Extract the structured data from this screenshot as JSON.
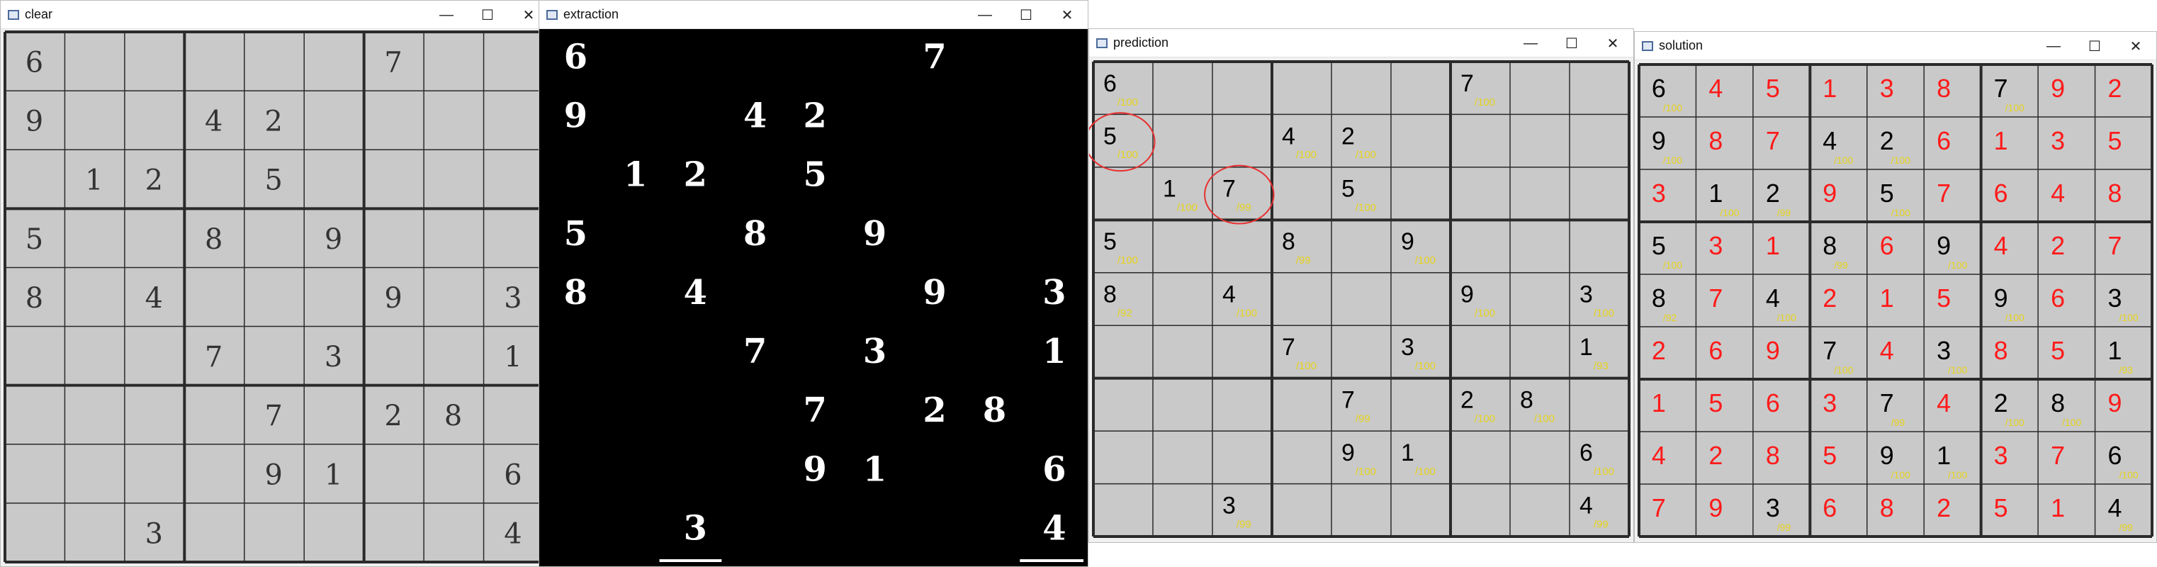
{
  "windows": {
    "clear": {
      "title": "clear"
    },
    "extraction": {
      "title": "extraction"
    },
    "prediction": {
      "title": "prediction"
    },
    "solution": {
      "title": "solution"
    }
  },
  "controls": {
    "minimize": "—",
    "maximize": "☐",
    "close": "✕"
  },
  "colors": {
    "given_digit": "#000000",
    "solved_digit": "#ff1a1a",
    "confidence": "#e6d21a",
    "circle": "#e83030",
    "paper": "#c9c9c9"
  },
  "puzzle": [
    [
      6,
      0,
      0,
      0,
      0,
      0,
      7,
      0,
      0
    ],
    [
      9,
      0,
      0,
      4,
      2,
      0,
      0,
      0,
      0
    ],
    [
      0,
      1,
      2,
      0,
      5,
      0,
      0,
      0,
      0
    ],
    [
      5,
      0,
      0,
      8,
      0,
      9,
      0,
      0,
      0
    ],
    [
      8,
      0,
      4,
      0,
      0,
      0,
      9,
      0,
      3
    ],
    [
      0,
      0,
      0,
      7,
      0,
      3,
      0,
      0,
      1
    ],
    [
      0,
      0,
      0,
      0,
      7,
      0,
      2,
      8,
      0
    ],
    [
      0,
      0,
      0,
      0,
      9,
      1,
      0,
      0,
      6
    ],
    [
      0,
      0,
      3,
      0,
      0,
      0,
      0,
      0,
      4
    ]
  ],
  "prediction": {
    "digits": [
      [
        6,
        0,
        0,
        0,
        0,
        0,
        7,
        0,
        0
      ],
      [
        5,
        0,
        0,
        4,
        2,
        0,
        0,
        0,
        0
      ],
      [
        0,
        1,
        7,
        0,
        5,
        0,
        0,
        0,
        0
      ],
      [
        5,
        0,
        0,
        8,
        0,
        9,
        0,
        0,
        0
      ],
      [
        8,
        0,
        4,
        0,
        0,
        0,
        9,
        0,
        3
      ],
      [
        0,
        0,
        0,
        7,
        0,
        3,
        0,
        0,
        1
      ],
      [
        0,
        0,
        0,
        0,
        7,
        0,
        2,
        8,
        0
      ],
      [
        0,
        0,
        0,
        0,
        9,
        1,
        0,
        0,
        6
      ],
      [
        0,
        0,
        3,
        0,
        0,
        0,
        0,
        0,
        4
      ]
    ],
    "confidence": [
      [
        "/100",
        "",
        "",
        "",
        "",
        "",
        "/100",
        "",
        ""
      ],
      [
        "/100",
        "",
        "",
        "/100",
        "/100",
        "",
        "",
        "",
        ""
      ],
      [
        "",
        "/100",
        "/99",
        "",
        "/100",
        "",
        "",
        "",
        ""
      ],
      [
        "/100",
        "",
        "",
        "/99",
        "",
        "/100",
        "",
        "",
        ""
      ],
      [
        "/92",
        "",
        "/100",
        "",
        "",
        "",
        "/100",
        "",
        "/100"
      ],
      [
        "",
        "",
        "",
        "/100",
        "",
        "/100",
        "",
        "",
        "/93"
      ],
      [
        "",
        "",
        "",
        "",
        "/99",
        "",
        "/100",
        "/100",
        ""
      ],
      [
        "",
        "",
        "",
        "",
        "/100",
        "/100",
        "",
        "",
        "/100"
      ],
      [
        "",
        "",
        "/99",
        "",
        "",
        "",
        "",
        "",
        "/99"
      ]
    ],
    "circled": [
      [
        1,
        0
      ],
      [
        2,
        2
      ]
    ]
  },
  "solution": {
    "digits": [
      [
        6,
        4,
        5,
        1,
        3,
        8,
        7,
        9,
        2
      ],
      [
        9,
        8,
        7,
        4,
        2,
        6,
        1,
        3,
        5
      ],
      [
        3,
        1,
        2,
        9,
        5,
        7,
        6,
        4,
        8
      ],
      [
        5,
        3,
        1,
        8,
        6,
        9,
        4,
        2,
        7
      ],
      [
        8,
        7,
        4,
        2,
        1,
        5,
        9,
        6,
        3
      ],
      [
        2,
        6,
        9,
        7,
        4,
        3,
        8,
        5,
        1
      ],
      [
        1,
        5,
        6,
        3,
        7,
        4,
        2,
        8,
        9
      ],
      [
        4,
        2,
        8,
        5,
        9,
        1,
        3,
        7,
        6
      ],
      [
        7,
        9,
        3,
        6,
        8,
        2,
        5,
        1,
        4
      ]
    ]
  }
}
